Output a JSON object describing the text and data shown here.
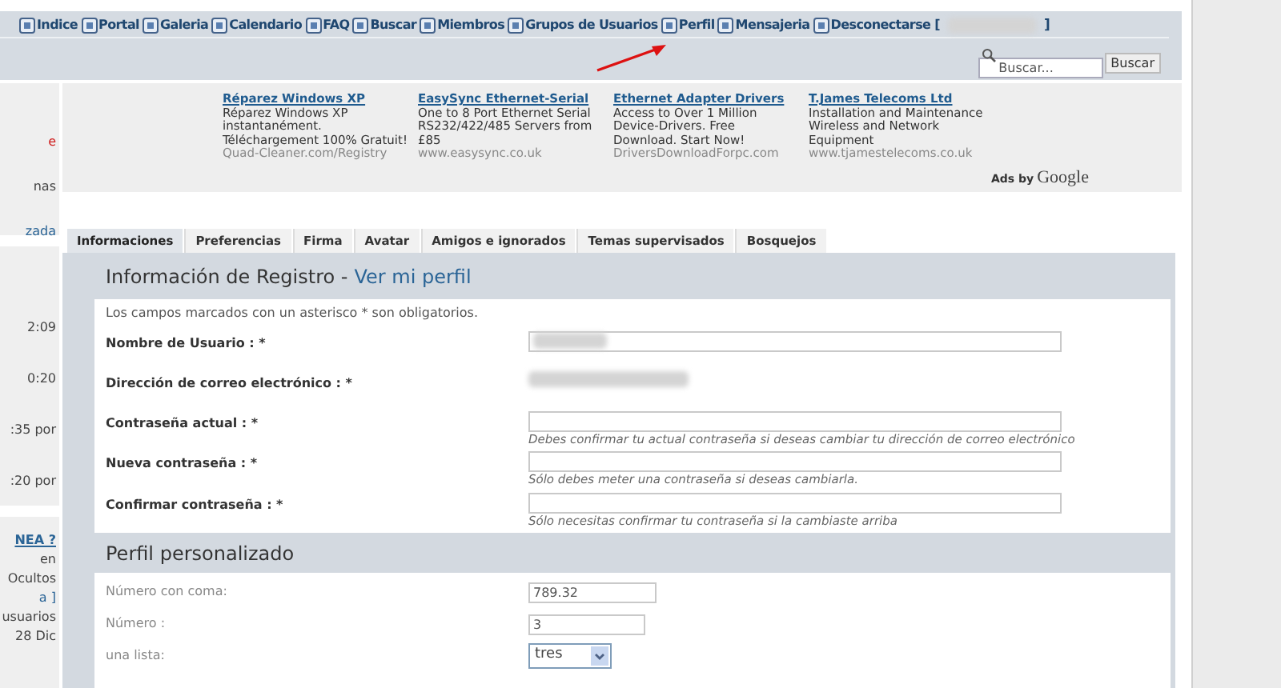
{
  "nav": {
    "items": [
      {
        "label": "Indice"
      },
      {
        "label": "Portal"
      },
      {
        "label": "Galeria"
      },
      {
        "label": "Calendario"
      },
      {
        "label": "FAQ"
      },
      {
        "label": "Buscar"
      },
      {
        "label": "Miembros"
      },
      {
        "label": "Grupos de Usuarios"
      },
      {
        "label": "Perfil"
      },
      {
        "label": "Mensajeria"
      },
      {
        "label": "Desconectarse ["
      }
    ],
    "close_bracket": "]",
    "search": {
      "placeholder": "Buscar...",
      "button": "Buscar"
    }
  },
  "sidebar": {
    "blocks": [
      {
        "lines": [
          {
            "text": "e",
            "kind": "alert"
          },
          {
            "text": "nas",
            "kind": "plain"
          },
          {
            "text": "zada",
            "kind": "link"
          }
        ]
      },
      {
        "lines": [
          {
            "text": "2:09",
            "kind": "plain"
          },
          {
            "text": "0:20",
            "kind": "plain"
          },
          {
            "text": ":35 por",
            "kind": "plain"
          },
          {
            "text": ":20 por",
            "kind": "plain"
          }
        ]
      },
      {
        "lines": [
          {
            "text": "NEA ?",
            "kind": "heading"
          },
          {
            "text": "en",
            "kind": "plain"
          },
          {
            "text": "Ocultos",
            "kind": "plain"
          },
          {
            "text": "a ]",
            "kind": "link"
          },
          {
            "text": "usuarios",
            "kind": "plain"
          },
          {
            "text": "28 Dic",
            "kind": "plain"
          }
        ]
      }
    ]
  },
  "ads": {
    "items": [
      {
        "title": "Réparez Windows XP",
        "body": "Réparez Windows XP instantanément. Téléchargement 100% Gratuit!",
        "url": "Quad-Cleaner.com/Registry"
      },
      {
        "title": "EasySync Ethernet-Serial",
        "body": "One to 8 Port Ethernet Serial RS232/422/485 Servers from £85",
        "url": "www.easysync.co.uk"
      },
      {
        "title": "Ethernet Adapter Drivers",
        "body": "Access to Over 1 Million Device-Drivers. Free Download. Start Now!",
        "url": "DriversDownloadForpc.com"
      },
      {
        "title": "T.James Telecoms Ltd",
        "body": "Installation and Maintenance Wireless and Network Equipment",
        "url": "www.tjamestelecoms.co.uk"
      }
    ],
    "ads_by": "Ads by",
    "brand": "Google"
  },
  "tabs": [
    {
      "label": "Informaciones",
      "selected": true
    },
    {
      "label": "Preferencias",
      "selected": false
    },
    {
      "label": "Firma",
      "selected": false
    },
    {
      "label": "Avatar",
      "selected": false
    },
    {
      "label": "Amigos e ignorados",
      "selected": false
    },
    {
      "label": "Temas supervisados",
      "selected": false
    },
    {
      "label": "Bosquejos",
      "selected": false
    }
  ],
  "registration": {
    "title": "Información de Registro - ",
    "link": "Ver mi perfil",
    "note": "Los campos marcados con un asterisco * son obligatorios.",
    "fields": [
      {
        "label": "Nombre de Usuario : *",
        "kind": "blurred-input"
      },
      {
        "label": "Dirección de correo electrónico : *",
        "kind": "blurred-text"
      },
      {
        "label": "Contraseña actual : *",
        "kind": "input",
        "hint": "Debes confirmar tu actual contraseña si deseas cambiar tu dirección de correo electrónico"
      },
      {
        "label": "Nueva contraseña : *",
        "kind": "input",
        "hint": "Sólo debes meter una contraseña si deseas cambiarla."
      },
      {
        "label": "Confirmar contraseña : *",
        "kind": "input",
        "hint": "Sólo necesitas confirmar tu contraseña si la cambiaste arriba"
      }
    ]
  },
  "custom_profile": {
    "title": "Perfil personalizado",
    "fields": [
      {
        "label": "Número con coma:",
        "kind": "input",
        "value": "789.32"
      },
      {
        "label": "Número :",
        "kind": "short-input",
        "value": "3"
      },
      {
        "label": "una lista:",
        "kind": "select",
        "value": "tres"
      }
    ]
  }
}
